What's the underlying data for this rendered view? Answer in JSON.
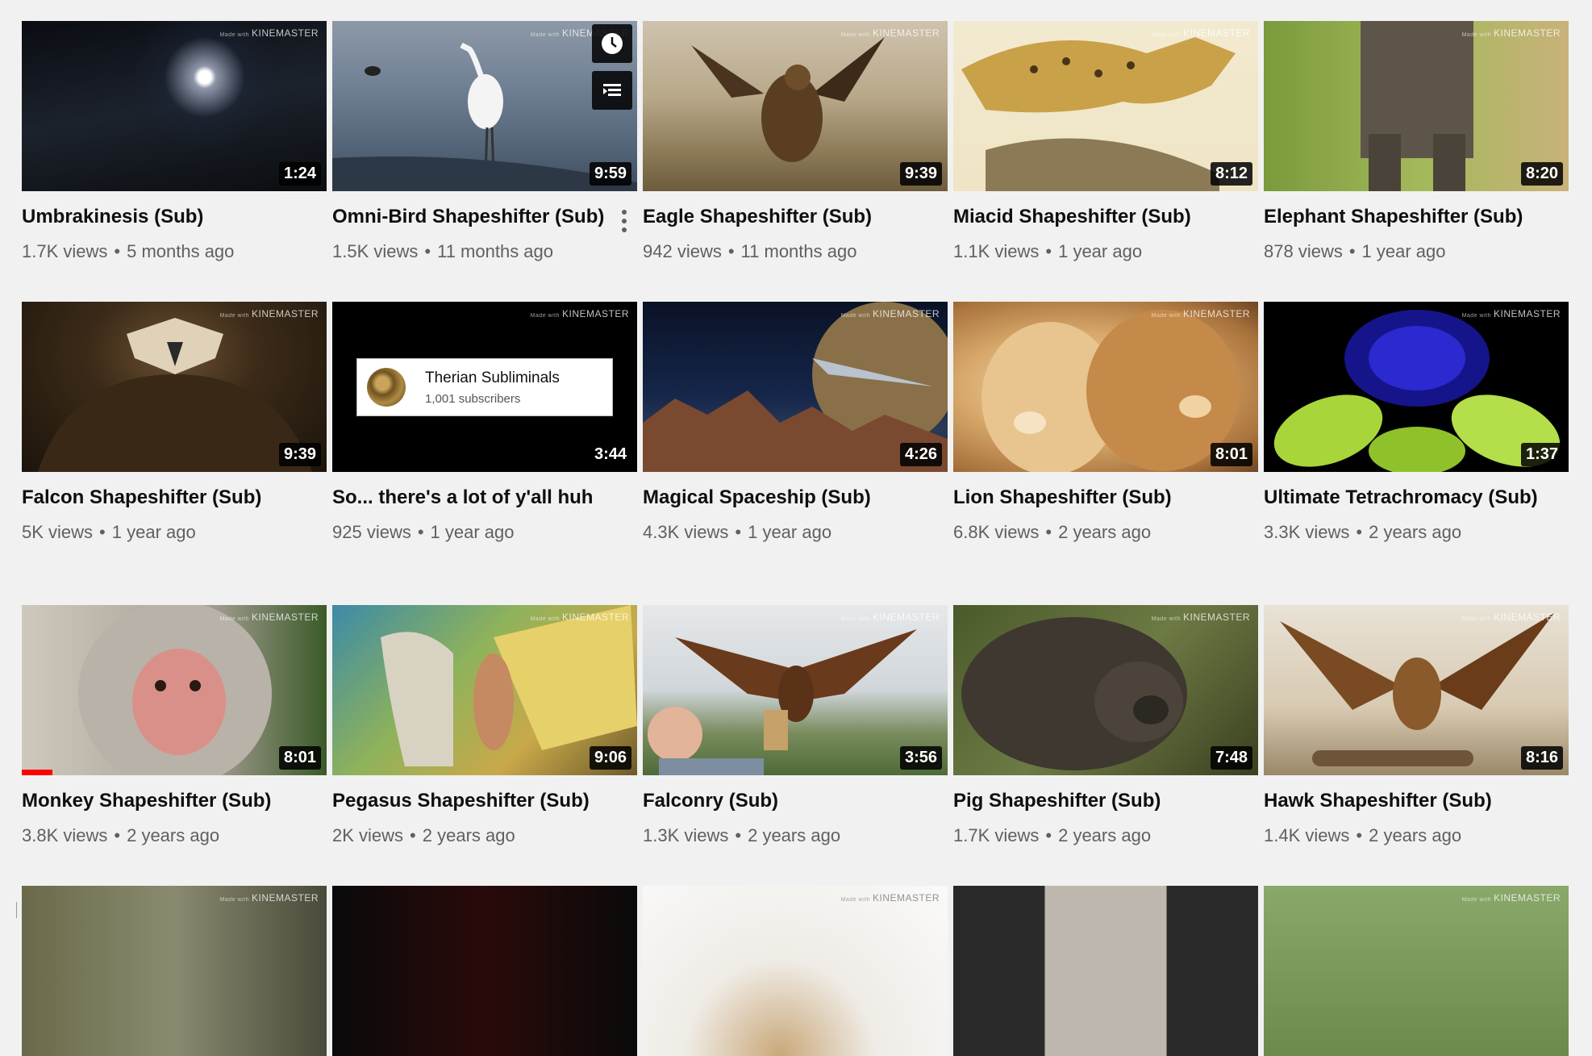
{
  "watermark": {
    "prefix": "Made with",
    "brand": "KINEMASTER"
  },
  "channel_card": {
    "name": "Therian Subliminals",
    "subs": "1,001 subscribers"
  },
  "videos": [
    {
      "title": "Umbrakinesis (Sub)",
      "views": "1.7K views",
      "age": "5 months ago",
      "duration": "1:24"
    },
    {
      "title": "Omni-Bird Shapeshifter (Sub)",
      "views": "1.5K views",
      "age": "11 months ago",
      "duration": "9:59"
    },
    {
      "title": "Eagle Shapeshifter (Sub)",
      "views": "942 views",
      "age": "11 months ago",
      "duration": "9:39"
    },
    {
      "title": "Miacid Shapeshifter (Sub)",
      "views": "1.1K views",
      "age": "1 year ago",
      "duration": "8:12"
    },
    {
      "title": "Elephant Shapeshifter (Sub)",
      "views": "878 views",
      "age": "1 year ago",
      "duration": "8:20"
    },
    {
      "title": "Falcon Shapeshifter (Sub)",
      "views": "5K views",
      "age": "1 year ago",
      "duration": "9:39"
    },
    {
      "title": "So... there's a lot of y'all huh",
      "views": "925 views",
      "age": "1 year ago",
      "duration": "3:44"
    },
    {
      "title": "Magical Spaceship (Sub)",
      "views": "4.3K views",
      "age": "1 year ago",
      "duration": "4:26"
    },
    {
      "title": "Lion Shapeshifter (Sub)",
      "views": "6.8K views",
      "age": "2 years ago",
      "duration": "8:01"
    },
    {
      "title": "Ultimate Tetrachromacy (Sub)",
      "views": "3.3K views",
      "age": "2 years ago",
      "duration": "1:37"
    },
    {
      "title": "Monkey Shapeshifter (Sub)",
      "views": "3.8K views",
      "age": "2 years ago",
      "duration": "8:01",
      "watched_fraction": 0.1
    },
    {
      "title": "Pegasus Shapeshifter (Sub)",
      "views": "2K views",
      "age": "2 years ago",
      "duration": "9:06"
    },
    {
      "title": "Falconry (Sub)",
      "views": "1.3K views",
      "age": "2 years ago",
      "duration": "3:56"
    },
    {
      "title": "Pig Shapeshifter (Sub)",
      "views": "1.7K views",
      "age": "2 years ago",
      "duration": "7:48"
    },
    {
      "title": "Hawk Shapeshifter (Sub)",
      "views": "1.4K views",
      "age": "2 years ago",
      "duration": "8:16"
    }
  ],
  "icons": {
    "watch_later": "clock-icon",
    "add_to_queue": "queue-icon",
    "more": "vertical-dots-icon"
  },
  "colors": {
    "background": "#f1f1f1",
    "progress": "#ff0000",
    "title": "#0f0f0f",
    "meta": "#606060"
  }
}
